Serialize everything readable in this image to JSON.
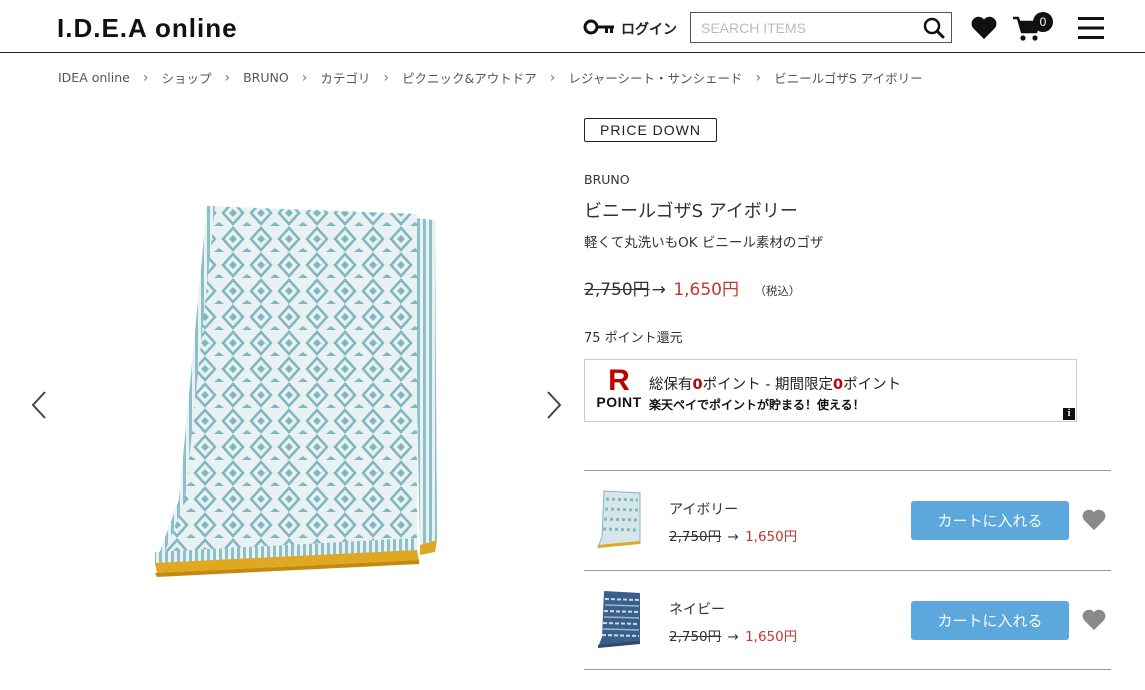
{
  "header": {
    "logo": "I.D.E.A online",
    "login_label": "ログイン",
    "search_placeholder": "SEARCH ITEMS",
    "cart_count": "0"
  },
  "breadcrumb": [
    "IDEA online",
    "ショップ",
    "BRUNO",
    "カテゴリ",
    "ピクニック&アウトドア",
    "レジャーシート・サンシェード",
    "ビニールゴザS アイボリー"
  ],
  "product": {
    "tag": "PRICE DOWN",
    "brand": "BRUNO",
    "title": "ビニールゴザS アイボリー",
    "subtitle": "軽くて丸洗いもOK ビニール素材のゴザ",
    "old_price": "2,750円",
    "arrow": "→",
    "new_price": "1,650円",
    "tax": "（税込）",
    "points": "75 ポイント還元"
  },
  "rakuten": {
    "logo_r": "R",
    "logo_point": "POINT",
    "line1_a": "総保有",
    "line1_b": "0",
    "line1_c": "ポイント - 期間限定",
    "line1_d": "0",
    "line1_e": "ポイント",
    "line2": "楽天ペイでポイントが貯まる！使える！",
    "info": "i"
  },
  "variants": [
    {
      "name": "アイボリー",
      "old_price": "2,750円",
      "arrow": "→",
      "new_price": "1,650円",
      "button": "カートに入れる"
    },
    {
      "name": "ネイビー",
      "old_price": "2,750円",
      "arrow": "→",
      "new_price": "1,650円",
      "button": "カートに入れる"
    }
  ],
  "colors": {
    "accent": "#5ca8dd",
    "sale": "#c0392b",
    "rakuten": "#bf0000",
    "mat_blue": "#7fb7c0",
    "mat_border": "#e0a820",
    "navy": "#3a5f8a"
  },
  "icons": [
    "key-icon",
    "search-icon",
    "heart-icon",
    "cart-icon",
    "hamburger-menu-icon",
    "chevron-left-icon",
    "chevron-right-icon",
    "info-icon"
  ]
}
